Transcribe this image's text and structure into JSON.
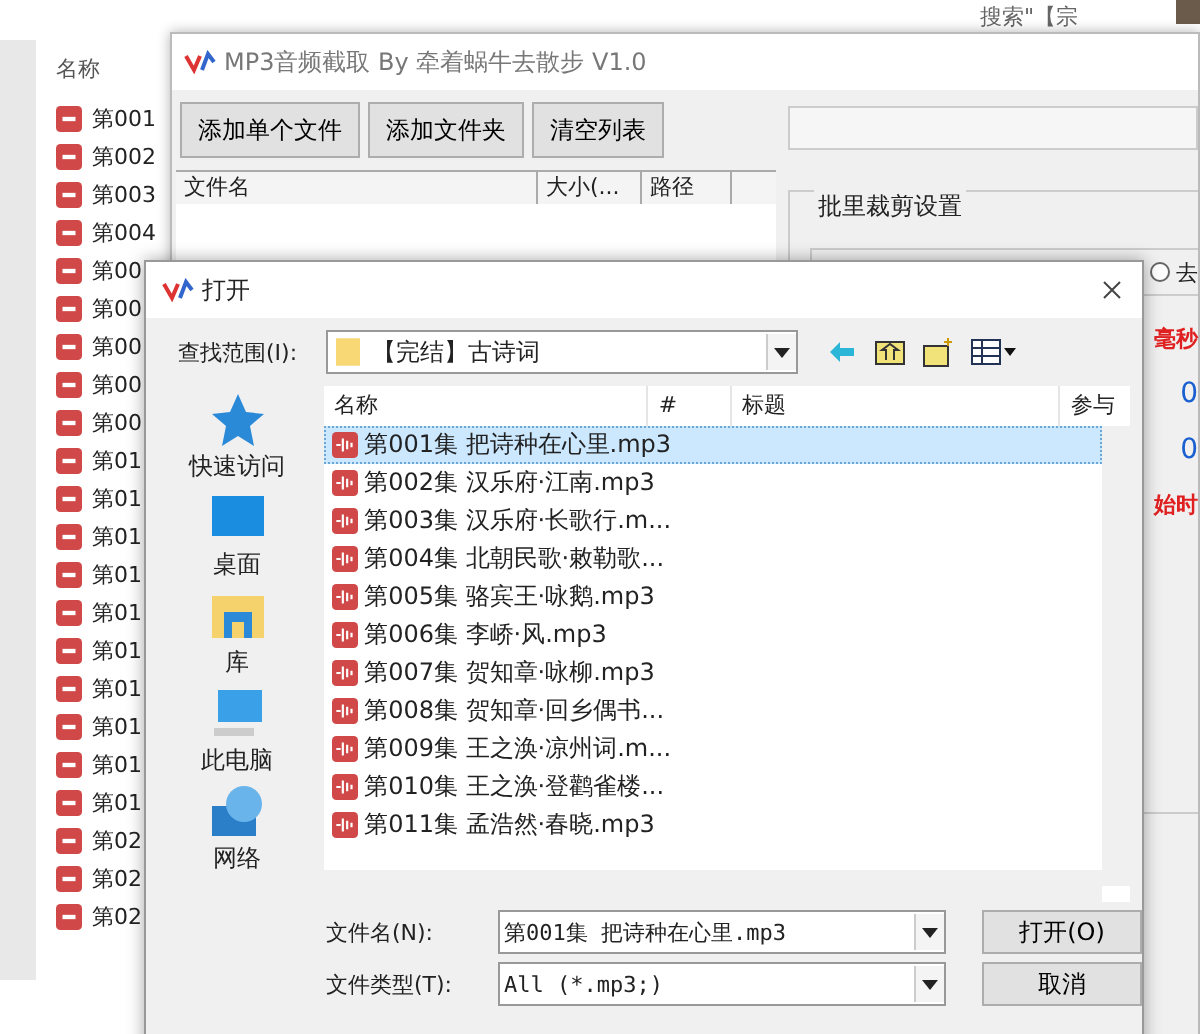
{
  "explorer": {
    "column_header": "名称",
    "search": {
      "placeholder": "搜索\"【宗"
    },
    "items": [
      "第001",
      "第002",
      "第003",
      "第004",
      "第00",
      "第00",
      "第00",
      "第00",
      "第00",
      "第01",
      "第01",
      "第01",
      "第01",
      "第01",
      "第01",
      "第01",
      "第01",
      "第01",
      "第01",
      "第02",
      "第02",
      "第02"
    ]
  },
  "app_window": {
    "title": "MP3音频截取 By 牵着蜗牛去散步 V1.0",
    "buttons": [
      "添加单个文件",
      "添加文件夹",
      "清空列表"
    ],
    "table": {
      "columns": [
        "文件名",
        "大小(...",
        "路径"
      ]
    },
    "settings": {
      "group_title": "批里裁剪设置",
      "radio_label": "去",
      "radio_selected": false,
      "side_texts": [
        {
          "text": "毫秒",
          "kind": "warn"
        },
        {
          "text": "0",
          "kind": "value"
        },
        {
          "text": "0",
          "kind": "value"
        },
        {
          "text": "始时",
          "kind": "warn"
        }
      ]
    }
  },
  "dialog": {
    "title": "打开",
    "look_in_label": "查找范围(I):",
    "look_in_value": "【完结】古诗词",
    "places": [
      {
        "label": "快速访问",
        "kind": "star"
      },
      {
        "label": "桌面",
        "kind": "desktop"
      },
      {
        "label": "库",
        "kind": "library"
      },
      {
        "label": "此电脑",
        "kind": "computer"
      },
      {
        "label": "网络",
        "kind": "network"
      }
    ],
    "columns": [
      "名称",
      "#",
      "标题",
      "参与"
    ],
    "files": [
      {
        "name": "第001集 把诗种在心里.mp3",
        "selected": true
      },
      {
        "name": "第002集 汉乐府·江南.mp3",
        "selected": false
      },
      {
        "name": "第003集 汉乐府·长歌行.m...",
        "selected": false
      },
      {
        "name": "第004集 北朝民歌·敕勒歌...",
        "selected": false
      },
      {
        "name": "第005集 骆宾王·咏鹅.mp3",
        "selected": false
      },
      {
        "name": "第006集 李峤·风.mp3",
        "selected": false
      },
      {
        "name": "第007集 贺知章·咏柳.mp3",
        "selected": false
      },
      {
        "name": "第008集 贺知章·回乡偶书...",
        "selected": false
      },
      {
        "name": "第009集 王之涣·凉州词.m...",
        "selected": false
      },
      {
        "name": "第010集 王之涣·登鹳雀楼...",
        "selected": false
      },
      {
        "name": "第011集 孟浩然·春晓.mp3",
        "selected": false
      }
    ],
    "file_name_label": "文件名(N):",
    "file_name_value": "第001集 把诗种在心里.mp3",
    "file_type_label": "文件类型(T):",
    "file_type_value": "All (*.mp3;)",
    "buttons": [
      "打开(O)",
      "取消"
    ]
  }
}
